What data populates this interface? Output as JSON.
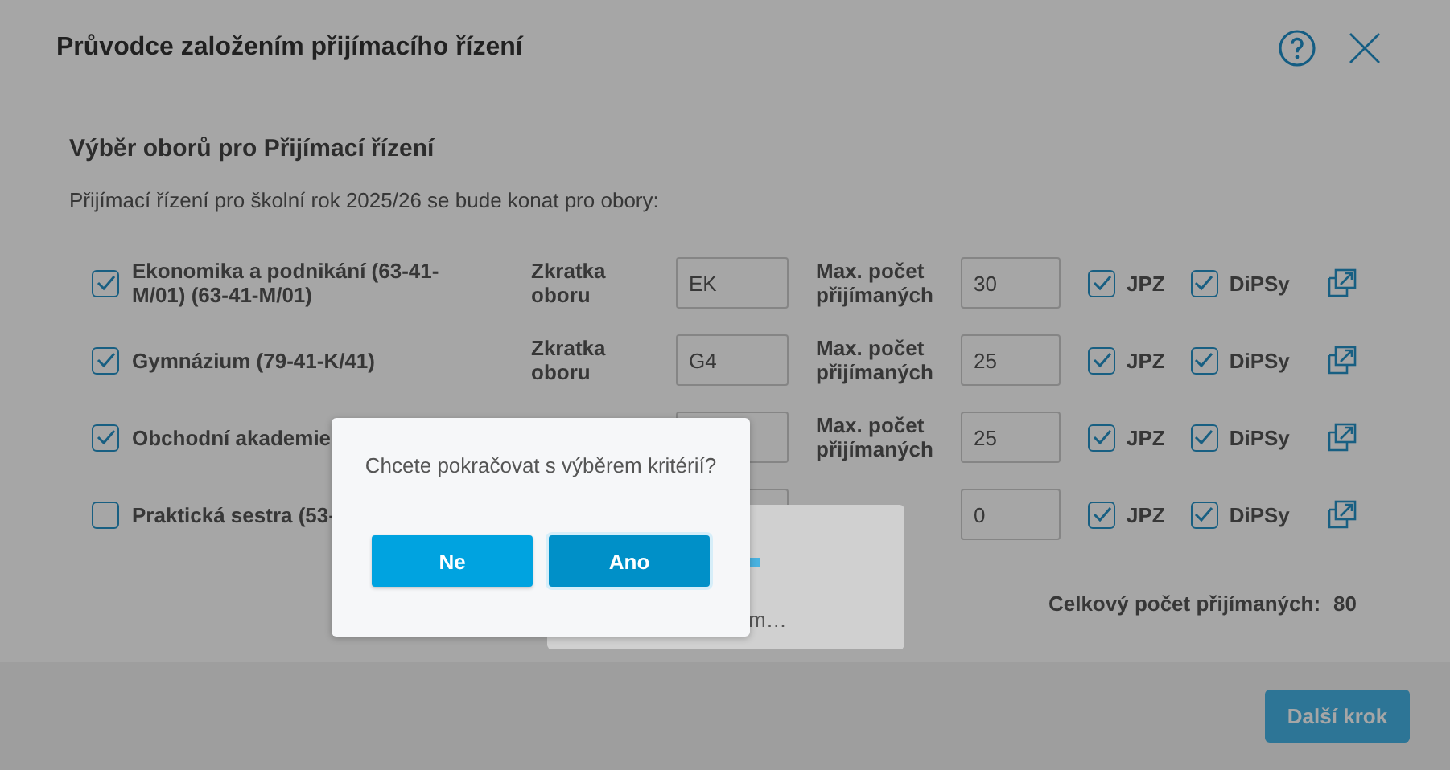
{
  "dialog": {
    "title": "Průvodce založením přijímacího řízení",
    "section_title": "Výběr oborů pro Přijímací řízení",
    "intro": "Přijímací řízení pro školní rok 2025/26 se bude konat pro obory:",
    "rows": [
      {
        "name": "Ekonomika a podnikání (63-41-M/01) (63-41-M/01)",
        "checked": true,
        "abbr_label": "Zkratka oboru",
        "abbr": "EK",
        "max_label": "Max. počet přijímaných",
        "max": "30",
        "jpz": {
          "label": "JPZ",
          "checked": true
        },
        "dipsy": {
          "label": "DiPSy",
          "checked": true
        }
      },
      {
        "name": "Gymnázium (79-41-K/41)",
        "checked": true,
        "abbr_label": "Zkratka oboru",
        "abbr": "G4",
        "max_label": "Max. počet přijímaných",
        "max": "25",
        "jpz": {
          "label": "JPZ",
          "checked": true
        },
        "dipsy": {
          "label": "DiPSy",
          "checked": true
        }
      },
      {
        "name": "Obchodní akademie",
        "checked": true,
        "max_label": "Max. počet přijímaných",
        "max": "25",
        "jpz": {
          "label": "JPZ",
          "checked": true
        },
        "dipsy": {
          "label": "DiPSy",
          "checked": true
        }
      },
      {
        "name": "Praktická sestra (53-",
        "checked": false,
        "max": "0",
        "jpz": {
          "label": "JPZ",
          "checked": true
        },
        "dipsy": {
          "label": "DiPSy",
          "checked": true
        }
      }
    ],
    "total_label": "Celkový počet přijímaných:",
    "total": "80",
    "next_button": "Další krok"
  },
  "loading": {
    "text": "m…"
  },
  "confirm": {
    "question": "Chcete pokračovat s výběrem kritérií?",
    "buttons": [
      {
        "label": "Ne",
        "selected": false
      },
      {
        "label": "Ano",
        "selected": true
      }
    ]
  }
}
